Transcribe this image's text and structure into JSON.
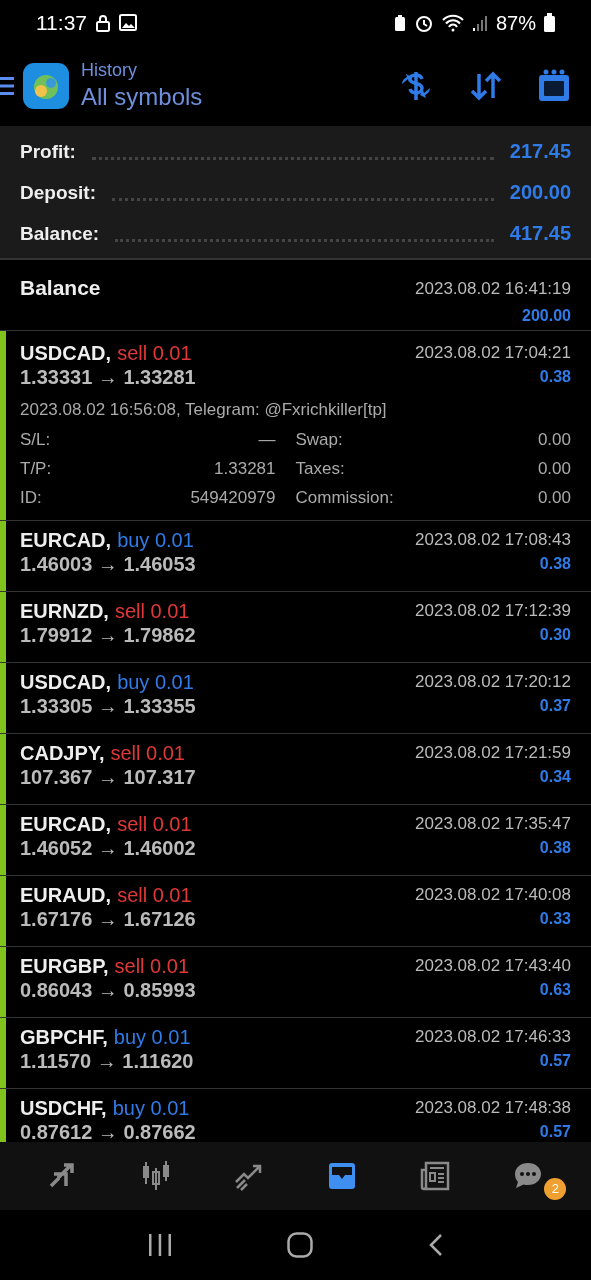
{
  "status_bar": {
    "time": "11:37",
    "battery": "87%"
  },
  "header": {
    "subtitle": "History",
    "title": "All symbols"
  },
  "summary": [
    {
      "label": "Profit:",
      "value": "217.45"
    },
    {
      "label": "Deposit:",
      "value": "200.00"
    },
    {
      "label": "Balance:",
      "value": "417.45"
    }
  ],
  "balance_entry": {
    "label": "Balance",
    "time": "2023.08.02 16:41:19",
    "amount": "200.00"
  },
  "trades": [
    {
      "symbol": "USDCAD,",
      "kind": "sell",
      "order": "sell 0.01",
      "prices": "1.33331 → 1.33281",
      "time": "2023.08.02 17:04:21",
      "profit": "0.38",
      "expanded": true,
      "comment": "2023.08.02 16:56:08, Telegram: @Fxrichkiller[tp]",
      "details": [
        {
          "label": "S/L:",
          "value": "—",
          "label_2": "Swap:",
          "value_2": "0.00"
        },
        {
          "label": "T/P:",
          "value": "1.33281",
          "label_2": "Taxes:",
          "value_2": "0.00"
        },
        {
          "label": "ID:",
          "value": "549420979",
          "label_2": "Commission:",
          "value_2": "0.00"
        }
      ]
    },
    {
      "symbol": "EURCAD,",
      "kind": "buy",
      "order": "buy 0.01",
      "prices": "1.46003 → 1.46053",
      "time": "2023.08.02 17:08:43",
      "profit": "0.38",
      "expanded": false
    },
    {
      "symbol": "EURNZD,",
      "kind": "sell",
      "order": "sell 0.01",
      "prices": "1.79912 → 1.79862",
      "time": "2023.08.02 17:12:39",
      "profit": "0.30",
      "expanded": false
    },
    {
      "symbol": "USDCAD,",
      "kind": "buy",
      "order": "buy 0.01",
      "prices": "1.33305 → 1.33355",
      "time": "2023.08.02 17:20:12",
      "profit": "0.37",
      "expanded": false
    },
    {
      "symbol": "CADJPY,",
      "kind": "sell",
      "order": "sell 0.01",
      "prices": "107.367 → 107.317",
      "time": "2023.08.02 17:21:59",
      "profit": "0.34",
      "expanded": false
    },
    {
      "symbol": "EURCAD,",
      "kind": "sell",
      "order": "sell 0.01",
      "prices": "1.46052 → 1.46002",
      "time": "2023.08.02 17:35:47",
      "profit": "0.38",
      "expanded": false
    },
    {
      "symbol": "EURAUD,",
      "kind": "sell",
      "order": "sell 0.01",
      "prices": "1.67176 → 1.67126",
      "time": "2023.08.02 17:40:08",
      "profit": "0.33",
      "expanded": false
    },
    {
      "symbol": "EURGBP,",
      "kind": "sell",
      "order": "sell 0.01",
      "prices": "0.86043 → 0.85993",
      "time": "2023.08.02 17:43:40",
      "profit": "0.63",
      "expanded": false
    },
    {
      "symbol": "GBPCHF,",
      "kind": "buy",
      "order": "buy 0.01",
      "prices": "1.11570 → 1.11620",
      "time": "2023.08.02 17:46:33",
      "profit": "0.57",
      "expanded": false
    },
    {
      "symbol": "USDCHF,",
      "kind": "buy",
      "order": "buy 0.01",
      "prices": "0.87612 → 0.87662",
      "time": "2023.08.02 17:48:38",
      "profit": "0.57",
      "expanded": false
    }
  ],
  "bottom_nav": [
    {
      "kind": "quotes",
      "selected": false
    },
    {
      "kind": "chart",
      "selected": false
    },
    {
      "kind": "trade",
      "selected": false
    },
    {
      "kind": "history",
      "selected": true
    },
    {
      "kind": "news",
      "selected": false
    },
    {
      "kind": "messages",
      "selected": false,
      "badge": "2"
    }
  ]
}
